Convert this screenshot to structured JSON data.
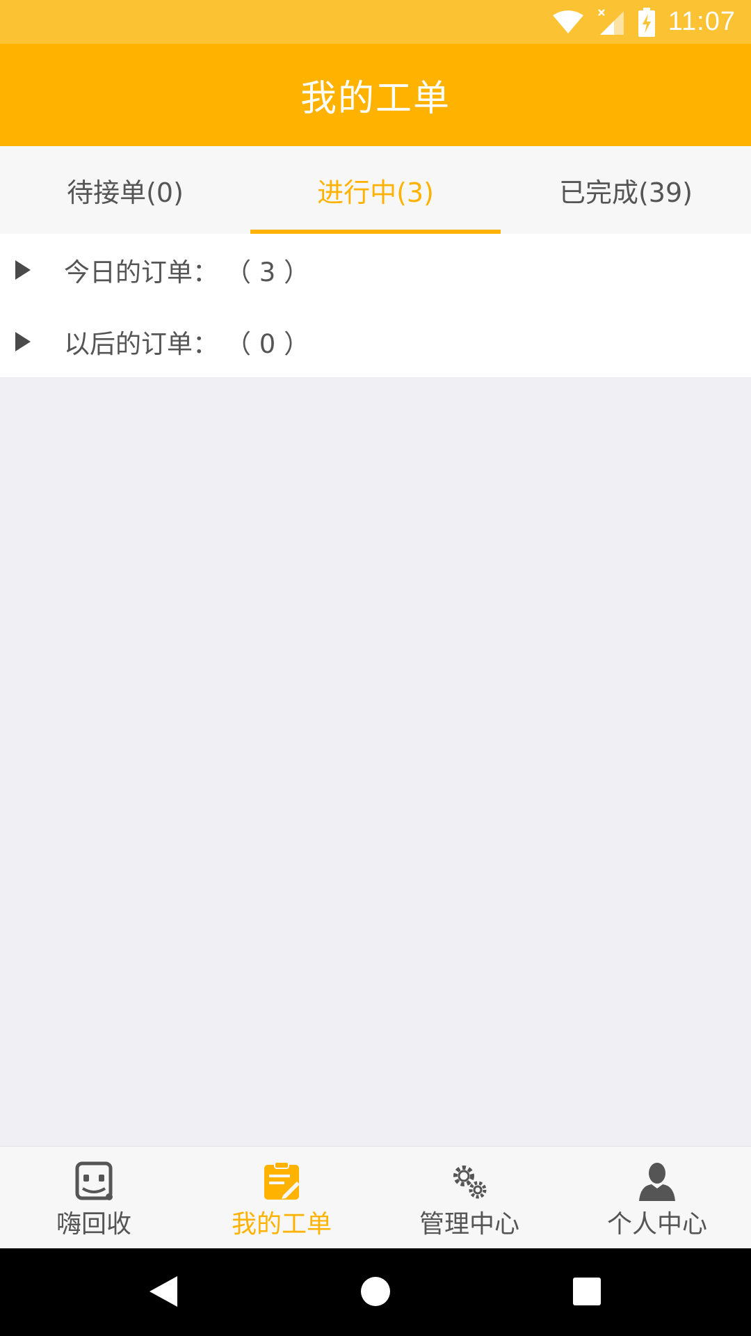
{
  "status_bar": {
    "time": "11:07",
    "icons": [
      "wifi-icon",
      "signal-icon",
      "battery-charging-icon"
    ]
  },
  "app_bar": {
    "title": "我的工单"
  },
  "tabs": [
    {
      "label": "待接单(0)",
      "active": false
    },
    {
      "label": "进行中(3)",
      "active": true
    },
    {
      "label": "已完成(39)",
      "active": false
    }
  ],
  "order_groups": [
    {
      "label": "今日的订单：",
      "count": "（ 3 ）",
      "icon": "caret-right-icon"
    },
    {
      "label": "以后的订单：",
      "count": "（ 0 ）",
      "icon": "caret-right-icon"
    }
  ],
  "bottom_nav": [
    {
      "label": "嗨回收",
      "icon": "robot-face-icon",
      "active": false
    },
    {
      "label": "我的工单",
      "icon": "clipboard-edit-icon",
      "active": true
    },
    {
      "label": "管理中心",
      "icon": "gears-icon",
      "active": false
    },
    {
      "label": "个人中心",
      "icon": "person-icon",
      "active": false
    }
  ],
  "colors": {
    "status_bar": "#fbc233",
    "accent": "#ffb300",
    "text": "#555555",
    "background": "#efeff4"
  }
}
